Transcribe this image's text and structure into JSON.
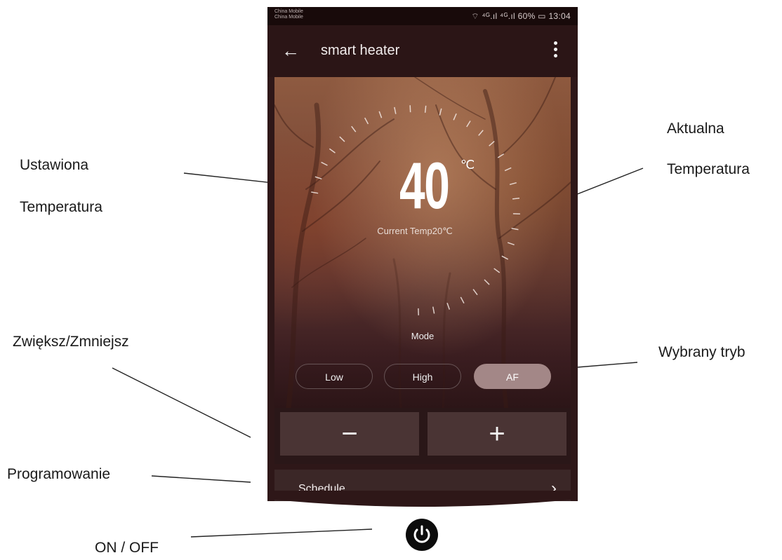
{
  "status_bar": {
    "carrier_1": "China Mobile",
    "carrier_2": "China Mobile",
    "indicators": "⌔ ⁴ᴳ.ıl ⁴ᴳ.ıl 60% ▭ 13:04"
  },
  "app_bar": {
    "back_icon": "arrow-left-icon",
    "title": "smart heater",
    "more_icon": "more-vertical-icon"
  },
  "thermostat": {
    "set_temperature": "40",
    "unit": "℃",
    "current_temp_text": "Current Temp20℃"
  },
  "mode": {
    "label": "Mode",
    "options": [
      "Low",
      "High",
      "AF"
    ],
    "selected": "AF"
  },
  "controls": {
    "decrease_symbol": "−",
    "increase_symbol": "+"
  },
  "schedule": {
    "label": "Schedule",
    "arrow_icon": "chevron-right-icon"
  },
  "power": {
    "icon": "power-icon"
  },
  "annotations": {
    "set_temp_line1": "Ustawiona",
    "set_temp_line2": "Temperatura",
    "current_temp_line1": "Aktualna",
    "current_temp_line2": "Temperatura",
    "increase_decrease": "Zwiększ/Zmniejsz",
    "selected_mode": "Wybrany tryb",
    "programming": "Programowanie",
    "on_off": "ON / OFF"
  },
  "colors": {
    "app_background": "#2e1718",
    "selected_mode": "#a38787",
    "step_button": "#4a3434"
  }
}
